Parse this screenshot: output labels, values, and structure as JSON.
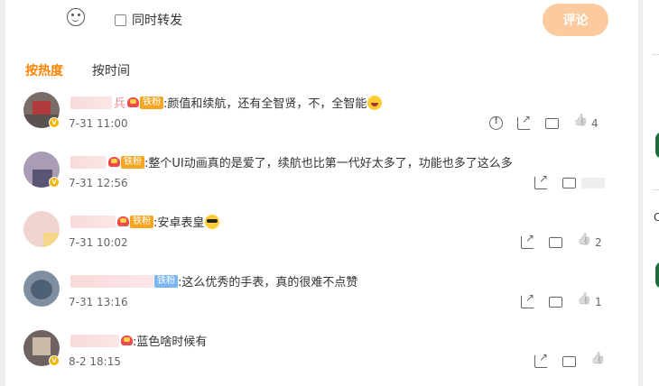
{
  "composer": {
    "forward_label": "同时转发",
    "post_label": "评论"
  },
  "tabs": [
    {
      "label": "按热度",
      "active": true
    },
    {
      "label": "按时间",
      "active": false
    }
  ],
  "comments": [
    {
      "name_suffix": "兵",
      "badge": "铁粉",
      "text": ":颜值和续航，还有全智贤，不，全智能",
      "emoji": "laugh-emoji",
      "time": "7-31 11:00",
      "likes": "4"
    },
    {
      "badge": "铁粉",
      "text": ":整个UI动画真的是爱了，续航也比第一代好太多了，功能也多了这么多",
      "emoji": "",
      "time": "7-31 12:56",
      "likes": ""
    },
    {
      "badge": "铁粉",
      "text": ":安卓表皇",
      "emoji": "cool-emoji",
      "time": "7-31 10:02",
      "likes": "2"
    },
    {
      "badge": "铁粉",
      "text": ":这么优秀的手表，真的很难不点赞",
      "emoji": "",
      "time": "7-31 13:16",
      "likes": "1"
    },
    {
      "badge": "",
      "text": ":蓝色啥时候有",
      "emoji": "",
      "time": "8-2 18:15",
      "likes": ""
    }
  ],
  "right_sidebar": {
    "char": "C"
  },
  "colors": {
    "accent": "#ff8200",
    "post_button": "#fcca9f",
    "badge_orange": "#f5a623",
    "badge_blue": "#7ab6f2"
  }
}
